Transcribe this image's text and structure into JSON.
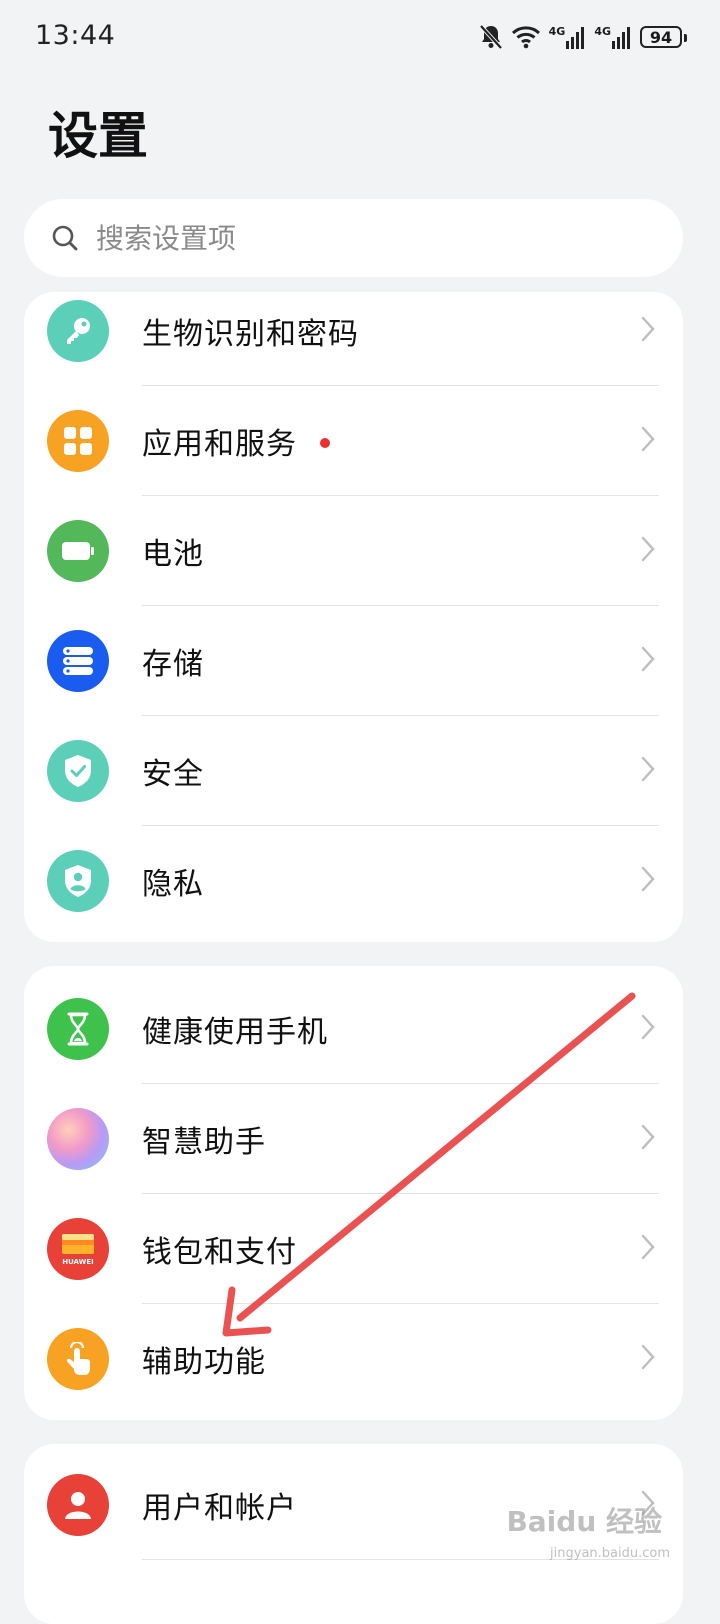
{
  "status_bar": {
    "time": "13:44",
    "network_1": "4G",
    "network_2": "4G",
    "battery": "94"
  },
  "page_title": "设置",
  "search": {
    "placeholder": "搜索设置项"
  },
  "group1": [
    {
      "label": "生物识别和密码",
      "icon": "key-icon",
      "color": "#5ccfb9"
    },
    {
      "label": "应用和服务",
      "icon": "apps-grid-icon",
      "color": "#f8a223",
      "badge": "red-dot"
    },
    {
      "label": "电池",
      "icon": "battery-icon",
      "color": "#53b85a"
    },
    {
      "label": "存储",
      "icon": "storage-icon",
      "color": "#1a5cf0"
    },
    {
      "label": "安全",
      "icon": "shield-check-icon",
      "color": "#5ccfb9"
    },
    {
      "label": "隐私",
      "icon": "privacy-shield-icon",
      "color": "#5ccfb9"
    }
  ],
  "group2": [
    {
      "label": "健康使用手机",
      "icon": "hourglass-icon",
      "color": "#3ec24c"
    },
    {
      "label": "智慧助手",
      "icon": "assistant-orb-icon",
      "color": "#c89af0"
    },
    {
      "label": "钱包和支付",
      "icon": "wallet-icon",
      "color": "#e84137",
      "icon_text": "HUAWEI"
    },
    {
      "label": "辅助功能",
      "icon": "touch-hand-icon",
      "color": "#f8a223"
    }
  ],
  "group3": [
    {
      "label": "用户和帐户",
      "icon": "user-icon",
      "color": "#e84137"
    }
  ],
  "watermark": {
    "text": "Baidu 经验",
    "url": "jingyan.baidu.com"
  },
  "annotation_arrow_color": "#ea5252"
}
